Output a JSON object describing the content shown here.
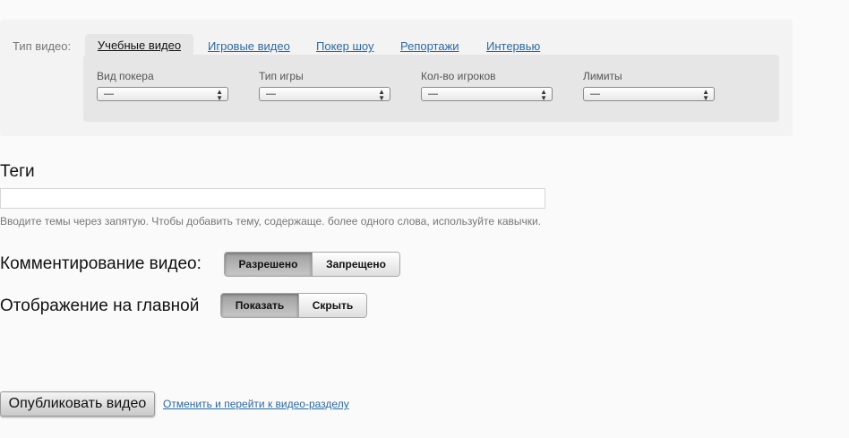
{
  "filters": {
    "type_label": "Тип видео:",
    "tabs": [
      {
        "label": "Учебные видео",
        "active": true
      },
      {
        "label": "Игровые видео",
        "active": false
      },
      {
        "label": "Покер шоу",
        "active": false
      },
      {
        "label": "Репортажи",
        "active": false
      },
      {
        "label": "Интервью",
        "active": false
      }
    ],
    "selects": [
      {
        "label": "Вид покера",
        "value": "—"
      },
      {
        "label": "Тип игры",
        "value": "—"
      },
      {
        "label": "Кол-во игроков",
        "value": "—"
      },
      {
        "label": "Лимиты",
        "value": "—"
      }
    ]
  },
  "tags": {
    "heading": "Теги",
    "value": "",
    "hint": "Вводите темы через запятую. Чтобы добавить тему, содержаще. более одного слова, используйте кавычки."
  },
  "comments": {
    "label": "Комментирование видео:",
    "on_label": "Разрешено",
    "off_label": "Запрещено",
    "selected": "Разрешено"
  },
  "homepage": {
    "label": "Отображение на главной",
    "on_label": "Показать",
    "off_label": "Скрыть",
    "selected": "Показать"
  },
  "actions": {
    "publish_label": "Опубликовать видео",
    "cancel_label": "Отменить и перейти к видео-разделу"
  }
}
